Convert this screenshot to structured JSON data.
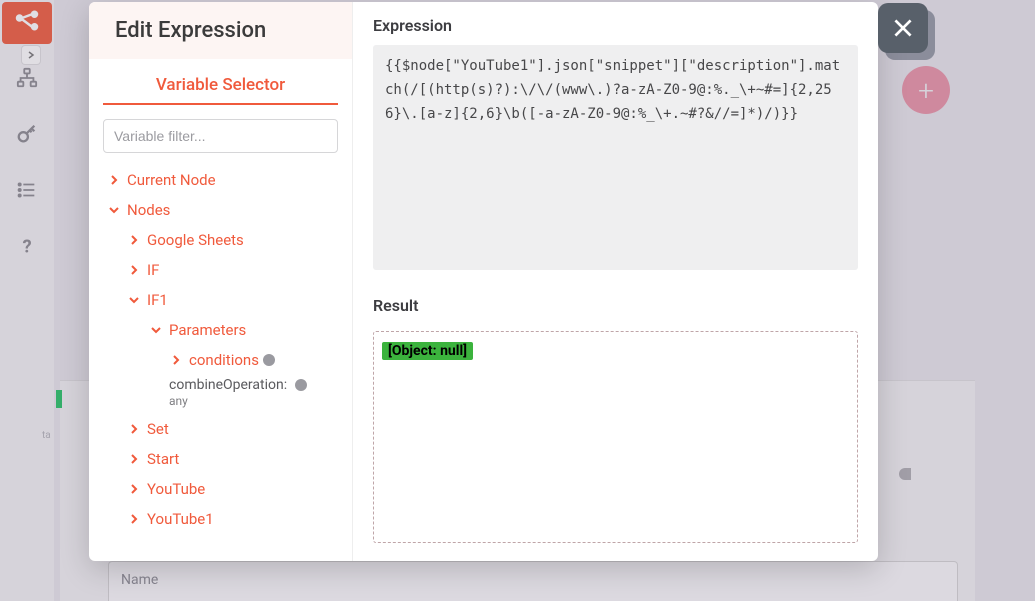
{
  "background": {
    "name_placeholder": "Name",
    "tiny_label": "ta"
  },
  "modal": {
    "title": "Edit Expression",
    "tab": "Variable Selector",
    "filter_placeholder": "Variable filter...",
    "tree": {
      "current_node": "Current Node",
      "nodes_label": "Nodes",
      "google_sheets": "Google Sheets",
      "if_label": "IF",
      "if1_label": "IF1",
      "parameters": "Parameters",
      "conditions": "conditions",
      "combineOperation_key": "combineOperation:",
      "combineOperation_val": "any",
      "set": "Set",
      "start": "Start",
      "youtube": "YouTube",
      "youtube1": "YouTube1"
    },
    "expression_label": "Expression",
    "expression_value": "{{$node[\"YouTube1\"].json[\"snippet\"][\"description\"].match(/[(http(s)?):\\/\\/(www\\.)?a-zA-Z0-9@:%._\\+~#=]{2,256}\\.[a-z]{2,6}\\b([-a-zA-Z0-9@:%_\\+.~#?&//=]*)/)}}",
    "result_label": "Result",
    "result_value": "[Object: null]"
  }
}
